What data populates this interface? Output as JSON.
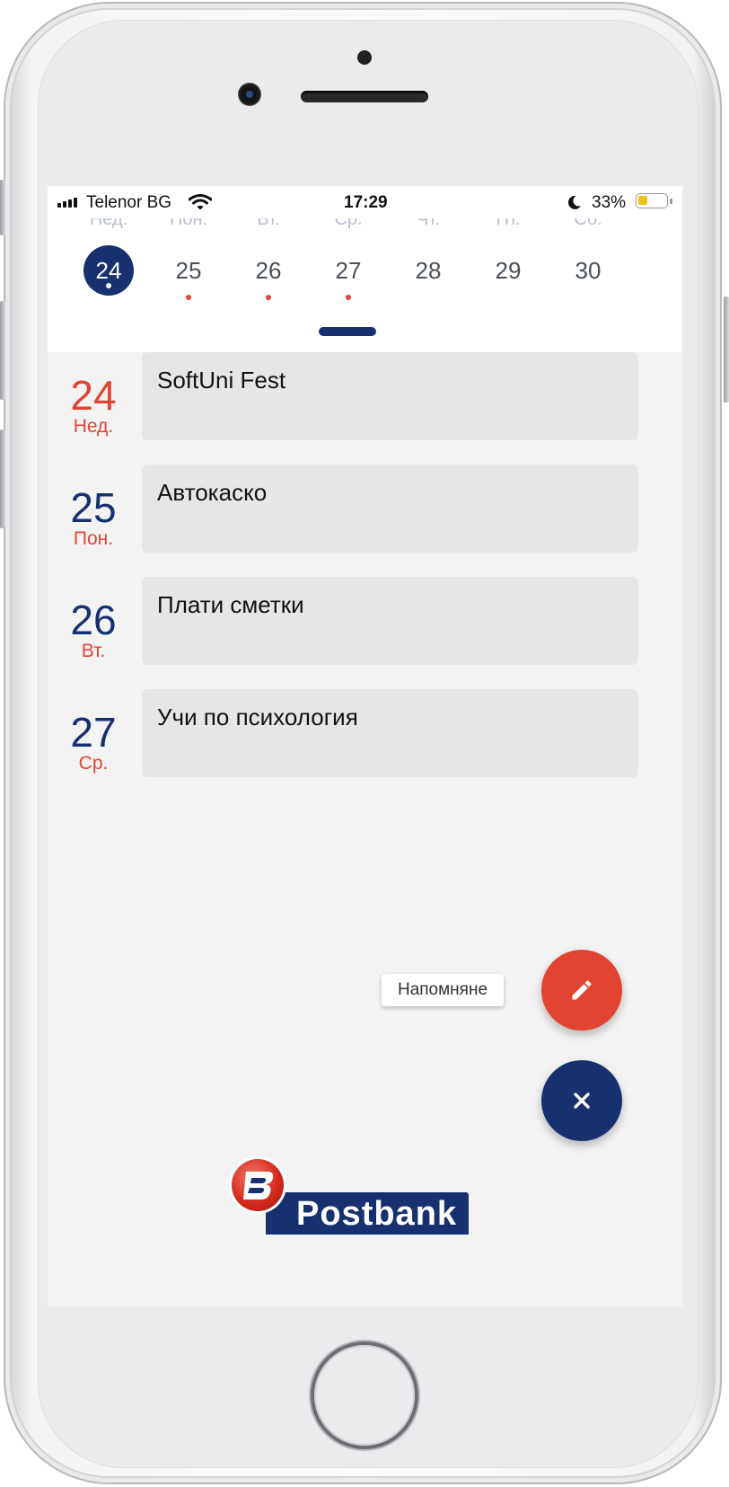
{
  "status_bar": {
    "carrier": "Telenor BG",
    "time": "17:29",
    "battery_percent": "33%",
    "battery_level": 0.33,
    "icons": [
      "signal-icon",
      "wifi-icon",
      "moon-icon",
      "battery-icon"
    ]
  },
  "week_strip": {
    "days": [
      {
        "dow": "Нед.",
        "date": "24",
        "selected": true,
        "has_event": true
      },
      {
        "dow": "Пон.",
        "date": "25",
        "selected": false,
        "has_event": true
      },
      {
        "dow": "Вт.",
        "date": "26",
        "selected": false,
        "has_event": true
      },
      {
        "dow": "Ср.",
        "date": "27",
        "selected": false,
        "has_event": true
      },
      {
        "dow": "Чт.",
        "date": "28",
        "selected": false,
        "has_event": false
      },
      {
        "dow": "Пт.",
        "date": "29",
        "selected": false,
        "has_event": false
      },
      {
        "dow": "Сб.",
        "date": "30",
        "selected": false,
        "has_event": false
      }
    ]
  },
  "events": [
    {
      "date": "24",
      "dow": "Нед.",
      "title": "SoftUni Fest"
    },
    {
      "date": "25",
      "dow": "Пон.",
      "title": "Автокаско"
    },
    {
      "date": "26",
      "dow": "Вт.",
      "title": "Плати сметки"
    },
    {
      "date": "27",
      "dow": "Ср.",
      "title": "Учи по психология"
    }
  ],
  "fab": {
    "reminder_label": "Напомняне",
    "reminder_icon": "pencil-icon",
    "close_icon": "close-icon"
  },
  "logo": {
    "text": "Postbank"
  },
  "colors": {
    "primary": "#17306f",
    "accent": "#e24432",
    "card": "#e6e6e7",
    "background": "#f3f3f4"
  }
}
